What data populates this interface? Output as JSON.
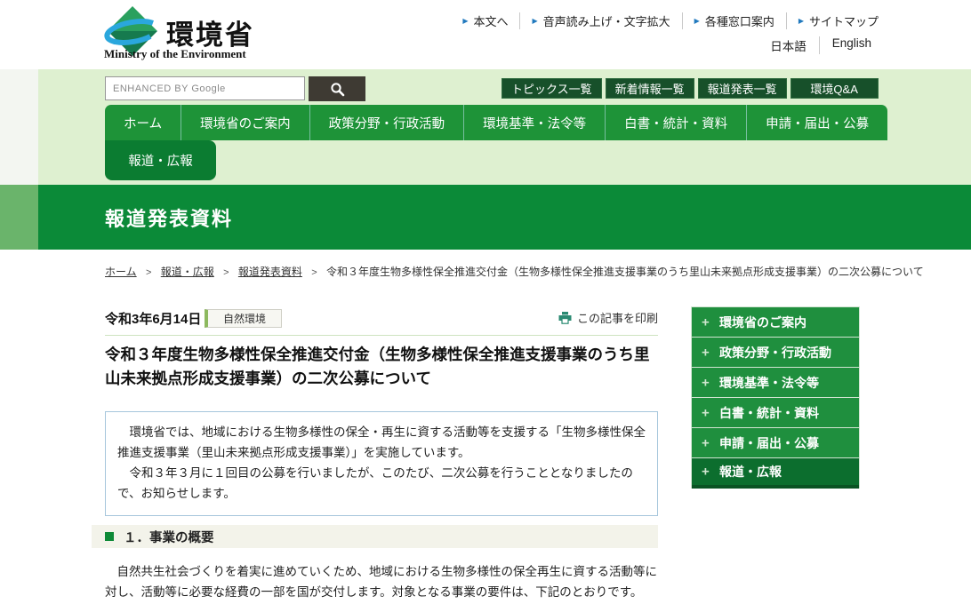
{
  "icons": {
    "arrow": "▶",
    "plus": "+"
  },
  "header": {
    "logo": {
      "name": "環境省",
      "subtitle": "Ministry of the Environment"
    },
    "utility_links": [
      "本文へ",
      "音声読み上げ・文字拡大",
      "各種窓口案内",
      "サイトマップ"
    ],
    "lang_links": [
      "日本語",
      "English"
    ]
  },
  "search": {
    "placeholder": "ENHANCED BY Google"
  },
  "quick_links": [
    "トピックス一覧",
    "新着情報一覧",
    "報道発表一覧",
    "環境Q&A"
  ],
  "nav": {
    "items": [
      "ホーム",
      "環境省のご案内",
      "政策分野・行政活動",
      "環境基準・法令等",
      "白書・統計・資料",
      "申請・届出・公募"
    ],
    "active_sub": "報道・広報"
  },
  "banner": {
    "title": "報道発表資料"
  },
  "breadcrumb": {
    "separator": ">",
    "links": [
      "ホーム",
      "報道・広報",
      "報道発表資料"
    ],
    "current": "令和３年度生物多様性保全推進交付金（生物多様性保全推進支援事業のうち里山未来拠点形成支援事業）の二次公募について"
  },
  "article": {
    "date": "令和3年6月14日",
    "category": "自然環境",
    "print_label": "この記事を印刷",
    "title": "令和３年度生物多様性保全推進交付金（生物多様性保全推進支援事業のうち里山未来拠点形成支援事業）の二次公募について",
    "summary_p1": "　環境省では、地域における生物多様性の保全・再生に資する活動等を支援する「生物多様性保全推進支援事業（里山未来拠点形成支援事業）」を実施しています。",
    "summary_p2": "　令和３年３月に１回目の公募を行いましたが、このたび、二次公募を行うこととなりましたので、お知らせします。",
    "section_heading": "１．事業の概要",
    "section_body": "　自然共生社会づくりを着実に進めていくため、地域における生物多様性の保全再生に資する活動等に対し、活動等に必要な経費の一部を国が交付します。対象となる事業の要件は、下記のとおりです。"
  },
  "sidebar": {
    "items": [
      {
        "label": "環境省のご案内"
      },
      {
        "label": "政策分野・行政活動"
      },
      {
        "label": "環境基準・法令等"
      },
      {
        "label": "白書・統計・資料"
      },
      {
        "label": "申請・届出・公募"
      },
      {
        "label": "報道・広報"
      }
    ]
  },
  "colors": {
    "banner_green": "#0b8a38",
    "nav_green": "#1e9338",
    "nav_active_green": "#0b7c31",
    "band_light_green": "#def0d0",
    "banner_side_green": "#6ab46b",
    "quick_button_green": "#17502a",
    "sidebar_green": "#1f8f3e",
    "sidebar_active_green": "#0c6e2e",
    "arrow_blue": "#2179be",
    "summary_border_blue": "#a6c6dc",
    "badge_accent_green": "#8db95f",
    "print_icon_teal": "#2a8a72",
    "search_button_dark": "#3e3a33"
  }
}
